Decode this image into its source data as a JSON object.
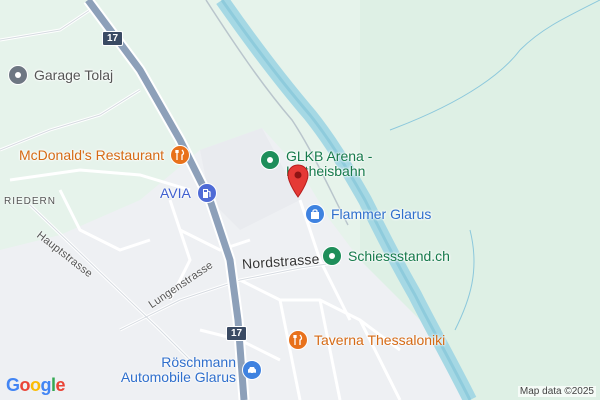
{
  "map": {
    "pois": [
      {
        "id": "garage",
        "name": "Garage Tolaj",
        "icon": "pin-icon",
        "color": "#6e7783"
      },
      {
        "id": "mcdonalds",
        "name": "McDonald's Restaurant",
        "icon": "fork-knife-icon",
        "color": "#e8711b"
      },
      {
        "id": "avia",
        "name": "AVIA",
        "icon": "gas-pump-icon",
        "color": "#4f6bd6"
      },
      {
        "id": "glkb",
        "name": "GLKB Arena - Lintheisbahn",
        "icon": "stadium-icon",
        "color": "#1e8e5a"
      },
      {
        "id": "flammer",
        "name": "Flammer Glarus",
        "icon": "shopping-bag-icon",
        "color": "#3f82e0"
      },
      {
        "id": "schiessstand",
        "name": "Schiessstand.ch",
        "icon": "stadium-icon",
        "color": "#1e8e5a"
      },
      {
        "id": "taverna",
        "name": "Taverna Thessaloniki",
        "icon": "fork-knife-icon",
        "color": "#e8711b"
      },
      {
        "id": "roschmann",
        "name": "Röschmann Automobile Glarus",
        "icon": "car-icon",
        "color": "#3f82e0"
      }
    ],
    "roads": {
      "route_number": "17",
      "nordstrasse": "Nordstrasse",
      "lungenstrasse": "Lungenstrasse",
      "hauptstrasse": "Hauptstrasse",
      "riedern": "RIEDERN"
    },
    "marker_icon": "location-marker-icon",
    "marker_color": "#e53935"
  },
  "footer": {
    "logo": "Google",
    "attribution": "Map data ©2025"
  }
}
